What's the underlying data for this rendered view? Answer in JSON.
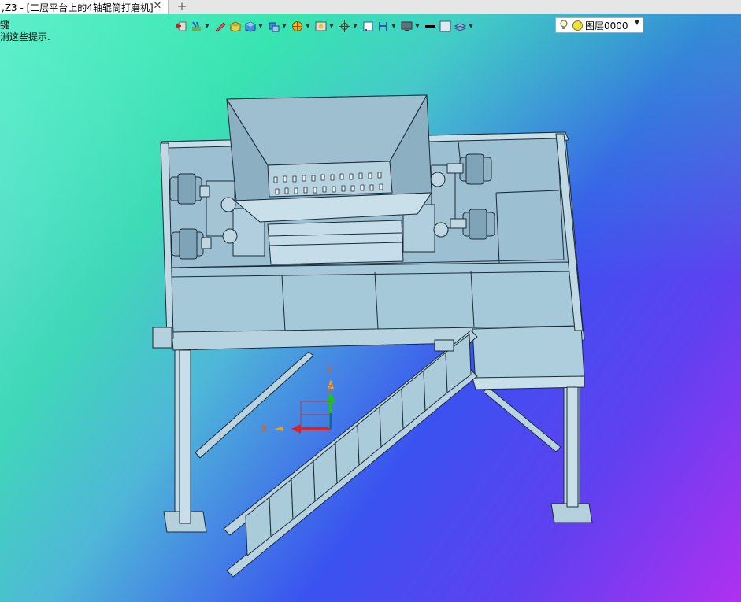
{
  "tab": {
    "title": ",Z3 - [二层平台上的4轴辊筒打磨机]",
    "close_icon": "close-icon",
    "add_icon": "plus-icon"
  },
  "hints": {
    "line1": "键",
    "line2": "消这些提示."
  },
  "toolbar": {
    "icons": [
      "exit-icon",
      "lighting-icon",
      "pencil-icon",
      "shaded-box-icon",
      "solid-view-icon",
      "view-orient-icon",
      "render-style-icon",
      "display-mode-icon",
      "snap-icon",
      "frame-icon",
      "section-icon",
      "monitor-icon",
      "line-color-icon",
      "fill-color-icon",
      "layer-stack-icon"
    ],
    "layer": {
      "label": "图层0000",
      "bulb_icon": "light-bulb-icon",
      "status_icon": "sun-icon",
      "dropdown_icon": "chevron-down-icon"
    }
  },
  "axes": {
    "x_label": "X",
    "y_label": "Y",
    "z_label": "Z"
  },
  "colors": {
    "model_fill": "#a8c8d8",
    "model_stroke": "#1a2a38",
    "x_axis": "#e02020",
    "y_axis": "#20c020",
    "z_axis": "#2050e0"
  }
}
